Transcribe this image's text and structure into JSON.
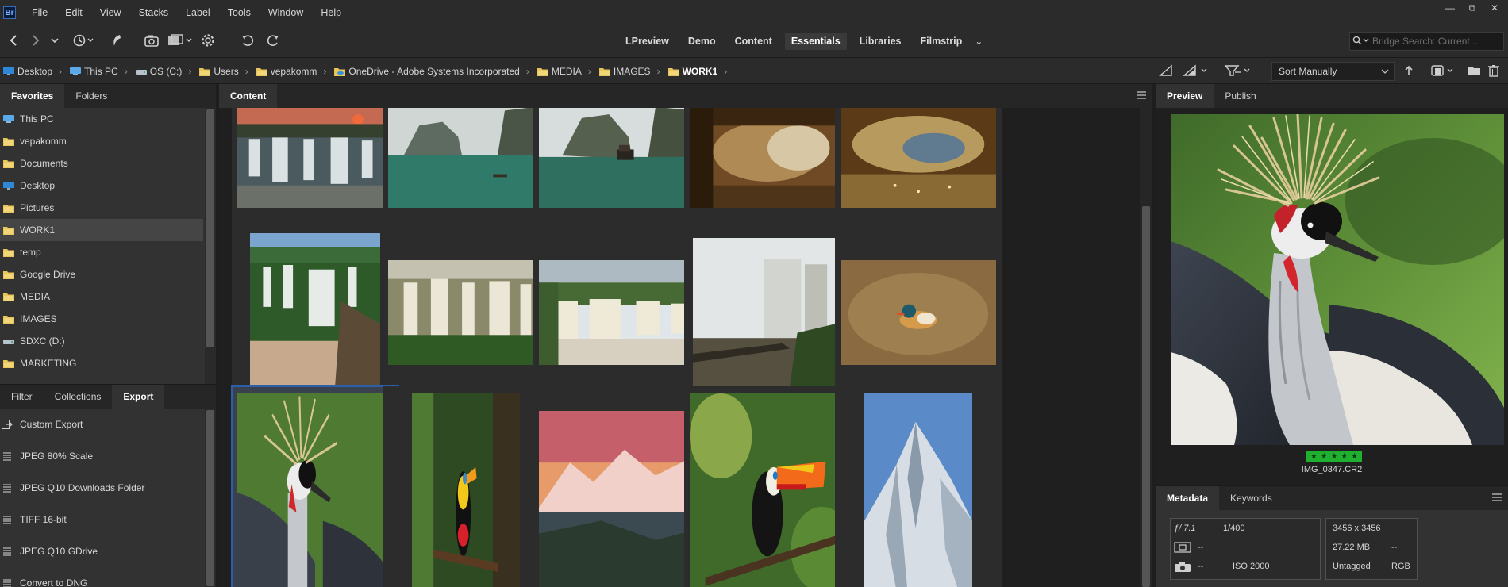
{
  "app": {
    "logo_text": "Br"
  },
  "menu": [
    "File",
    "Edit",
    "View",
    "Stacks",
    "Label",
    "Tools",
    "Window",
    "Help"
  ],
  "window_controls": {
    "minimize": "—",
    "restore": "⧉",
    "close": "✕"
  },
  "toolbar": {
    "icons": [
      "back-icon",
      "forward-icon",
      "recent-dropdown-icon",
      "history-icon",
      "boomerang-icon",
      "camera-import-icon",
      "refine-icon",
      "rotate-ccw-icon",
      "rotate-cw-icon"
    ]
  },
  "workspaces": {
    "tabs": [
      "LPreview",
      "Demo",
      "Content",
      "Essentials",
      "Libraries",
      "Filmstrip"
    ],
    "active": "Essentials",
    "more": "⌄"
  },
  "search": {
    "placeholder": "Bridge Search: Current...",
    "icon": "search-icon"
  },
  "breadcrumb": [
    {
      "label": "Desktop",
      "icon": "desktop-icon"
    },
    {
      "label": "This PC",
      "icon": "computer-icon"
    },
    {
      "label": "OS (C:)",
      "icon": "drive-icon"
    },
    {
      "label": "Users",
      "icon": "folder-icon"
    },
    {
      "label": "vepakomm",
      "icon": "folder-icon"
    },
    {
      "label": "OneDrive - Adobe Systems Incorporated",
      "icon": "cloud-folder-icon"
    },
    {
      "label": "MEDIA",
      "icon": "folder-icon"
    },
    {
      "label": "IMAGES",
      "icon": "folder-icon"
    },
    {
      "label": "WORK1",
      "icon": "folder-icon"
    }
  ],
  "sort": {
    "label": "Sort Manually"
  },
  "favorites_panel": {
    "tabs": [
      "Favorites",
      "Folders"
    ],
    "active": "Favorites",
    "items": [
      {
        "label": "This PC",
        "icon": "computer-icon"
      },
      {
        "label": "vepakomm",
        "icon": "folder-icon"
      },
      {
        "label": "Documents",
        "icon": "folder-icon"
      },
      {
        "label": "Desktop",
        "icon": "desktop-icon"
      },
      {
        "label": "Pictures",
        "icon": "folder-icon"
      },
      {
        "label": "WORK1",
        "icon": "folder-icon"
      },
      {
        "label": "temp",
        "icon": "folder-icon"
      },
      {
        "label": "Google Drive",
        "icon": "folder-icon"
      },
      {
        "label": "MEDIA",
        "icon": "folder-icon"
      },
      {
        "label": "IMAGES",
        "icon": "folder-icon"
      },
      {
        "label": "SDXC (D:)",
        "icon": "drive-icon"
      },
      {
        "label": "MARKETING",
        "icon": "folder-icon"
      }
    ],
    "selected": "WORK1"
  },
  "export_panel": {
    "tabs": [
      "Filter",
      "Collections",
      "Export"
    ],
    "active": "Export",
    "items": [
      "Custom Export",
      "JPEG 80% Scale",
      "JPEG Q10 Downloads Folder",
      "TIFF 16-bit",
      "JPEG Q10 GDrive",
      "Convert to DNG"
    ]
  },
  "content_panel": {
    "tab": "Content",
    "thumbnails": [
      {
        "subject": "waterfall-sunset"
      },
      {
        "subject": "halong-bay-mist"
      },
      {
        "subject": "halong-bay-boat"
      },
      {
        "subject": "cave-interior"
      },
      {
        "subject": "cave-interior-lit"
      },
      {
        "subject": "iguazu-falls-vertical"
      },
      {
        "subject": "iguazu-falls-wide"
      },
      {
        "subject": "iguazu-falls-aerial"
      },
      {
        "subject": "waterfall-mist-walkway"
      },
      {
        "subject": "mandarin-duck"
      },
      {
        "subject": "crowned-crane",
        "selected": true
      },
      {
        "subject": "toucan-on-branch"
      },
      {
        "subject": "mountain-pink-sky"
      },
      {
        "subject": "toucan-in-leaves"
      },
      {
        "subject": "snowy-peak"
      }
    ]
  },
  "preview_panel": {
    "tabs": [
      "Preview",
      "Publish"
    ],
    "active": "Preview",
    "rating": "★★★★★",
    "rating_value": 5,
    "file_name": "IMG_0347.CR2"
  },
  "metadata_panel": {
    "tabs": [
      "Metadata",
      "Keywords"
    ],
    "active": "Metadata",
    "aperture": "ƒ/ 7.1",
    "shutter": "1/400",
    "dim_1": "--",
    "dim_2": "--",
    "iso": "ISO 2000",
    "dimensions": "3456 x 3456",
    "file_size": "27.22 MB",
    "dash": "--",
    "tag": "Untagged",
    "color_mode": "RGB"
  },
  "colors": {
    "accent_selection": "#2d5fa8",
    "rating_green": "#20b030",
    "folder_yellow": "#e8c55a"
  }
}
